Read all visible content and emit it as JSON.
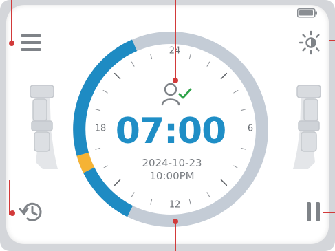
{
  "dial": {
    "labels": {
      "top": "24",
      "right": "6",
      "bottom": "12",
      "left": "18"
    },
    "segments": [
      {
        "name": "active",
        "color": "#1e8bc3"
      },
      {
        "name": "warning",
        "color": "#f5b335"
      },
      {
        "name": "track",
        "color": "#c4ccd6"
      }
    ]
  },
  "center": {
    "time": "07:00",
    "date": "2024-10-23",
    "clock": "10:00PM"
  },
  "icons": {
    "menu": "menu-icon",
    "brightness": "brightness-icon",
    "battery": "battery-icon",
    "history": "history-icon",
    "pause": "pause-icon",
    "user_status": "user-check-icon",
    "left_device": "leg-brace-icon",
    "right_device": "leg-brace-icon"
  },
  "colors": {
    "accent": "#1e8bc3",
    "warning": "#f5b335",
    "check": "#2fa34a",
    "callout": "#d23a3a",
    "track": "#c4ccd6"
  }
}
